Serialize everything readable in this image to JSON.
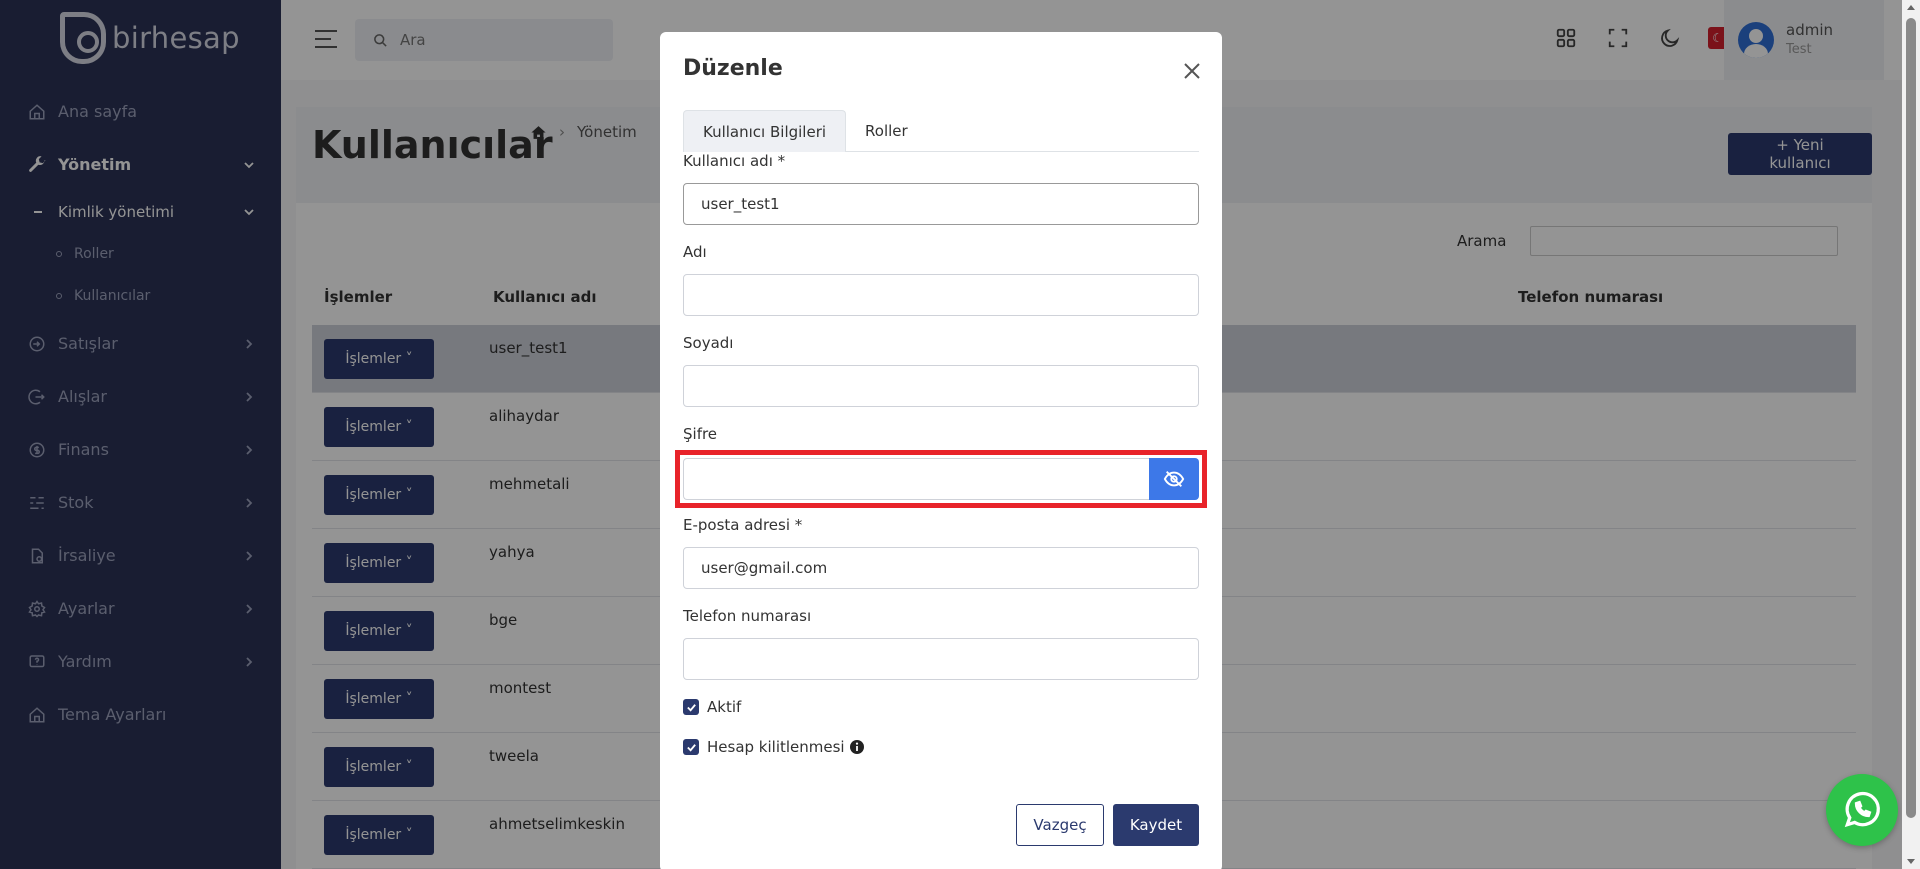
{
  "app": {
    "logo_text": "birhesap"
  },
  "sidebar": {
    "items": [
      {
        "label": "Ana sayfa",
        "icon": "home-icon"
      },
      {
        "label": "Yönetim",
        "icon": "wrench-icon"
      },
      {
        "label": "Kimlik yönetimi"
      },
      {
        "label": "Roller"
      },
      {
        "label": "Kullanıcılar"
      },
      {
        "label": "Satışlar",
        "icon": "sign-in-icon"
      },
      {
        "label": "Alışlar",
        "icon": "sign-out-icon"
      },
      {
        "label": "Finans",
        "icon": "coin-icon"
      },
      {
        "label": "Stok",
        "icon": "stock-icon"
      },
      {
        "label": "İrsaliye",
        "icon": "document-icon"
      },
      {
        "label": "Ayarlar",
        "icon": "gear-icon"
      },
      {
        "label": "Yardım",
        "icon": "help-icon"
      },
      {
        "label": "Tema Ayarları",
        "icon": "home-icon"
      }
    ]
  },
  "topbar": {
    "search_placeholder": "Ara",
    "user_name": "admin",
    "user_role": "Test"
  },
  "page": {
    "title": "Kullanıcılar",
    "breadcrumb": [
      "Yönetim"
    ],
    "new_user_button": "Yeni kullanıcı",
    "search_label": "Arama"
  },
  "table": {
    "headers": {
      "actions": "İşlemler",
      "username": "Kullanıcı adı",
      "phone": "Telefon numarası"
    },
    "action_button": "İşlemler",
    "rows": [
      "user_test1",
      "alihaydar",
      "mehmetali",
      "yahya",
      "bge",
      "montest",
      "tweela",
      "ahmetselimkeskin"
    ]
  },
  "modal": {
    "title": "Düzenle",
    "tabs": [
      "Kullanıcı Bilgileri",
      "Roller"
    ],
    "fields": {
      "username_label": "Kullanıcı adı *",
      "username_value": "user_test1",
      "name_label": "Adı",
      "name_value": "",
      "surname_label": "Soyadı",
      "surname_value": "",
      "password_label": "Şifre",
      "password_value": "",
      "email_label": "E-posta adresi *",
      "email_value": "user@gmail.com",
      "phone_label": "Telefon numarası",
      "phone_value": ""
    },
    "checkboxes": {
      "active_label": "Aktif",
      "lockout_label": "Hesap kilitlenmesi"
    },
    "cancel_button": "Vazgeç",
    "save_button": "Kaydet"
  },
  "colors": {
    "sidebar": "#2b3356",
    "primary": "#2b3a6e",
    "toggle_blue": "#3d78e8",
    "highlight_red": "#e8232a",
    "whatsapp_green": "#2ec24a"
  }
}
